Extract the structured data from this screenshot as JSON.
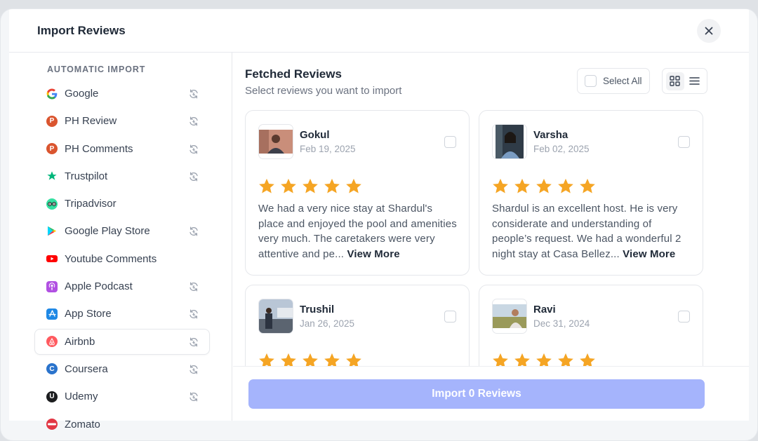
{
  "dialog": {
    "title": "Import Reviews"
  },
  "sidebar": {
    "heading": "AUTOMATIC IMPORT",
    "items": [
      {
        "label": "Google",
        "icon": "google-icon",
        "sync": true
      },
      {
        "label": "PH Review",
        "icon": "producthunt-icon",
        "sync": true
      },
      {
        "label": "PH Comments",
        "icon": "producthunt-icon",
        "sync": true
      },
      {
        "label": "Trustpilot",
        "icon": "trustpilot-star-icon",
        "sync": true
      },
      {
        "label": "Tripadvisor",
        "icon": "tripadvisor-icon",
        "sync": false
      },
      {
        "label": "Google Play Store",
        "icon": "google-play-icon",
        "sync": true
      },
      {
        "label": "Youtube Comments",
        "icon": "youtube-icon",
        "sync": false
      },
      {
        "label": "Apple Podcast",
        "icon": "apple-podcast-icon",
        "sync": true
      },
      {
        "label": "App Store",
        "icon": "app-store-icon",
        "sync": true
      },
      {
        "label": "Airbnb",
        "icon": "airbnb-icon",
        "sync": true,
        "active": true
      },
      {
        "label": "Coursera",
        "icon": "coursera-icon",
        "sync": true
      },
      {
        "label": "Udemy",
        "icon": "udemy-icon",
        "sync": true
      },
      {
        "label": "Zomato",
        "icon": "zomato-icon",
        "sync": false
      }
    ]
  },
  "main": {
    "title": "Fetched Reviews",
    "subtitle": "Select reviews you want to import",
    "select_all_label": "Select All",
    "view_mode": "grid",
    "reviews": [
      {
        "name": "Gokul",
        "date": "Feb 19, 2025",
        "rating": 5,
        "text": "We had a very nice stay at Shardul's place and enjoyed the pool and amenities very much. The caretakers were very attentive and pe...",
        "view_more": "View More"
      },
      {
        "name": "Varsha",
        "date": "Feb 02, 2025",
        "rating": 5,
        "text": "Shardul is an excellent host. He is very considerate and understanding of people’s request. We had a wonderful 2 night stay at Casa Bellez...",
        "view_more": "View More"
      },
      {
        "name": "Trushil",
        "date": "Jan 26, 2025",
        "rating": 5,
        "text": "",
        "view_more": ""
      },
      {
        "name": "Ravi",
        "date": "Dec 31, 2024",
        "rating": 5,
        "text": "",
        "view_more": ""
      }
    ]
  },
  "footer": {
    "import_label": "Import 0 Reviews"
  },
  "colors": {
    "star": "#f5a524",
    "import_button": "#a5b4fc",
    "google_blue": "#4285f4",
    "producthunt": "#da552f",
    "trustpilot": "#00b67a",
    "tripadvisor": "#34e0a1",
    "youtube": "#ff0000",
    "podcast": "#b150e2",
    "app_store": "#1e88e5",
    "airbnb": "#ff5a5f",
    "coursera": "#2a73cc",
    "udemy": "#1c1d1f",
    "zomato": "#e23744"
  }
}
